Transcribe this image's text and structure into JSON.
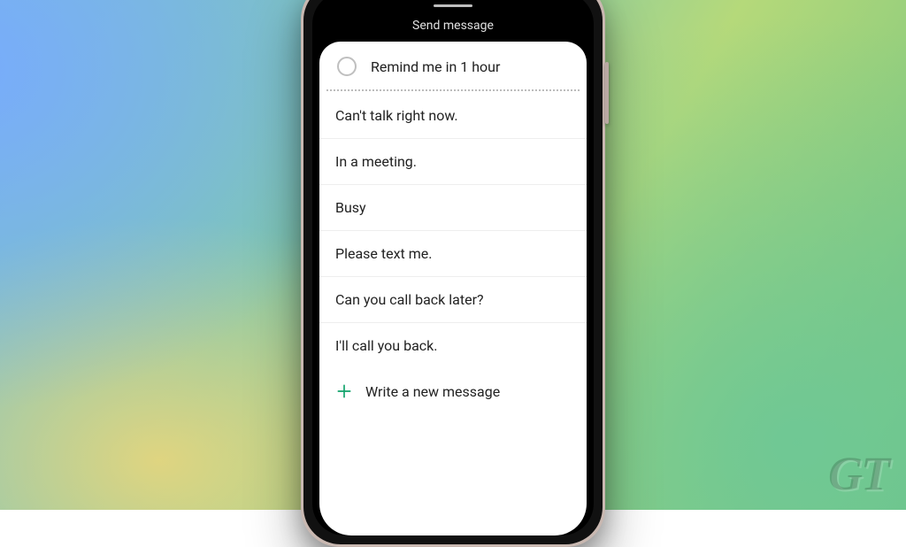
{
  "header": {
    "title": "Send message"
  },
  "remind": {
    "label": "Remind me in 1 hour"
  },
  "quick_replies": [
    "Can't talk right now.",
    "In a meeting.",
    "Busy",
    "Please text me.",
    "Can you call back later?",
    "I'll call you back."
  ],
  "new_message": {
    "label": "Write a new message"
  },
  "watermark": "GT",
  "colors": {
    "accent": "#11a36b"
  }
}
